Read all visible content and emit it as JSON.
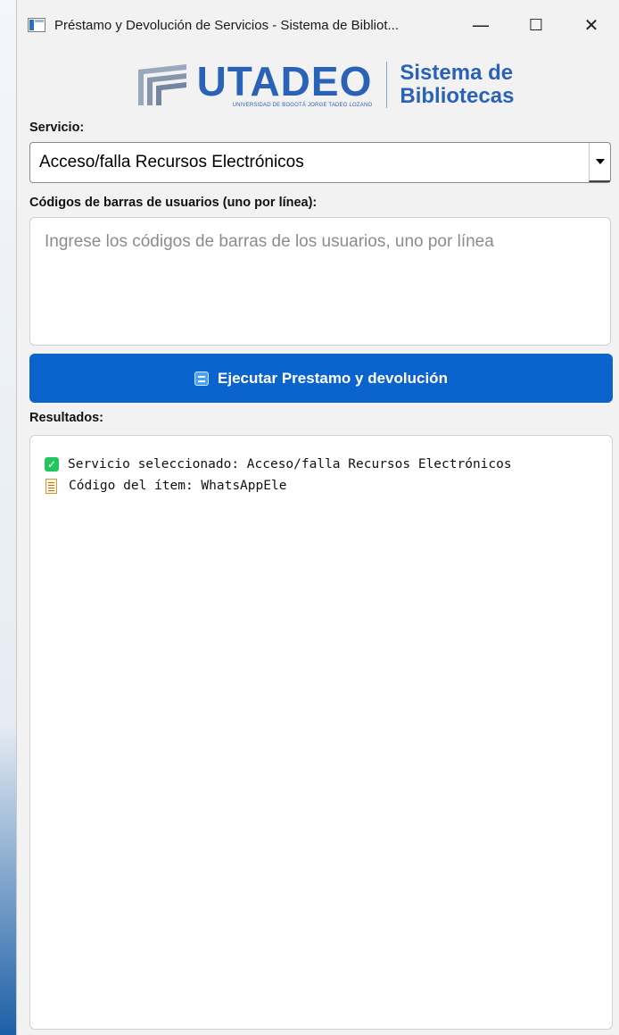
{
  "window": {
    "title": "Préstamo y Devolución de Servicios - Sistema de Bibliot...",
    "minimize_glyph": "—",
    "maximize_glyph": "☐",
    "close_glyph": "✕"
  },
  "logo": {
    "brand": "UTADEO",
    "brand_sub": "UNIVERSIDAD DE BOGOTÁ JORGE TADEO LOZANO",
    "system_line1": "Sistema de",
    "system_line2": "Bibliotecas",
    "brand_color": "#2a62b8"
  },
  "service": {
    "label": "Servicio:",
    "selected": "Acceso/falla Recursos Electrónicos"
  },
  "barcodes": {
    "label": "Códigos de barras de usuarios (uno por línea):",
    "placeholder": "Ingrese los códigos de barras de los usuarios, uno por línea"
  },
  "run_button": {
    "label": "Ejecutar Prestamo y devolución",
    "icon": "swap-icon",
    "color": "#0b63ce"
  },
  "results": {
    "label": "Resultados:",
    "lines": [
      {
        "icon": "check-icon",
        "text": "Servicio seleccionado: Acceso/falla Recursos Electrónicos"
      },
      {
        "icon": "memo-icon",
        "text": "Código del ítem: WhatsAppEle"
      }
    ]
  }
}
